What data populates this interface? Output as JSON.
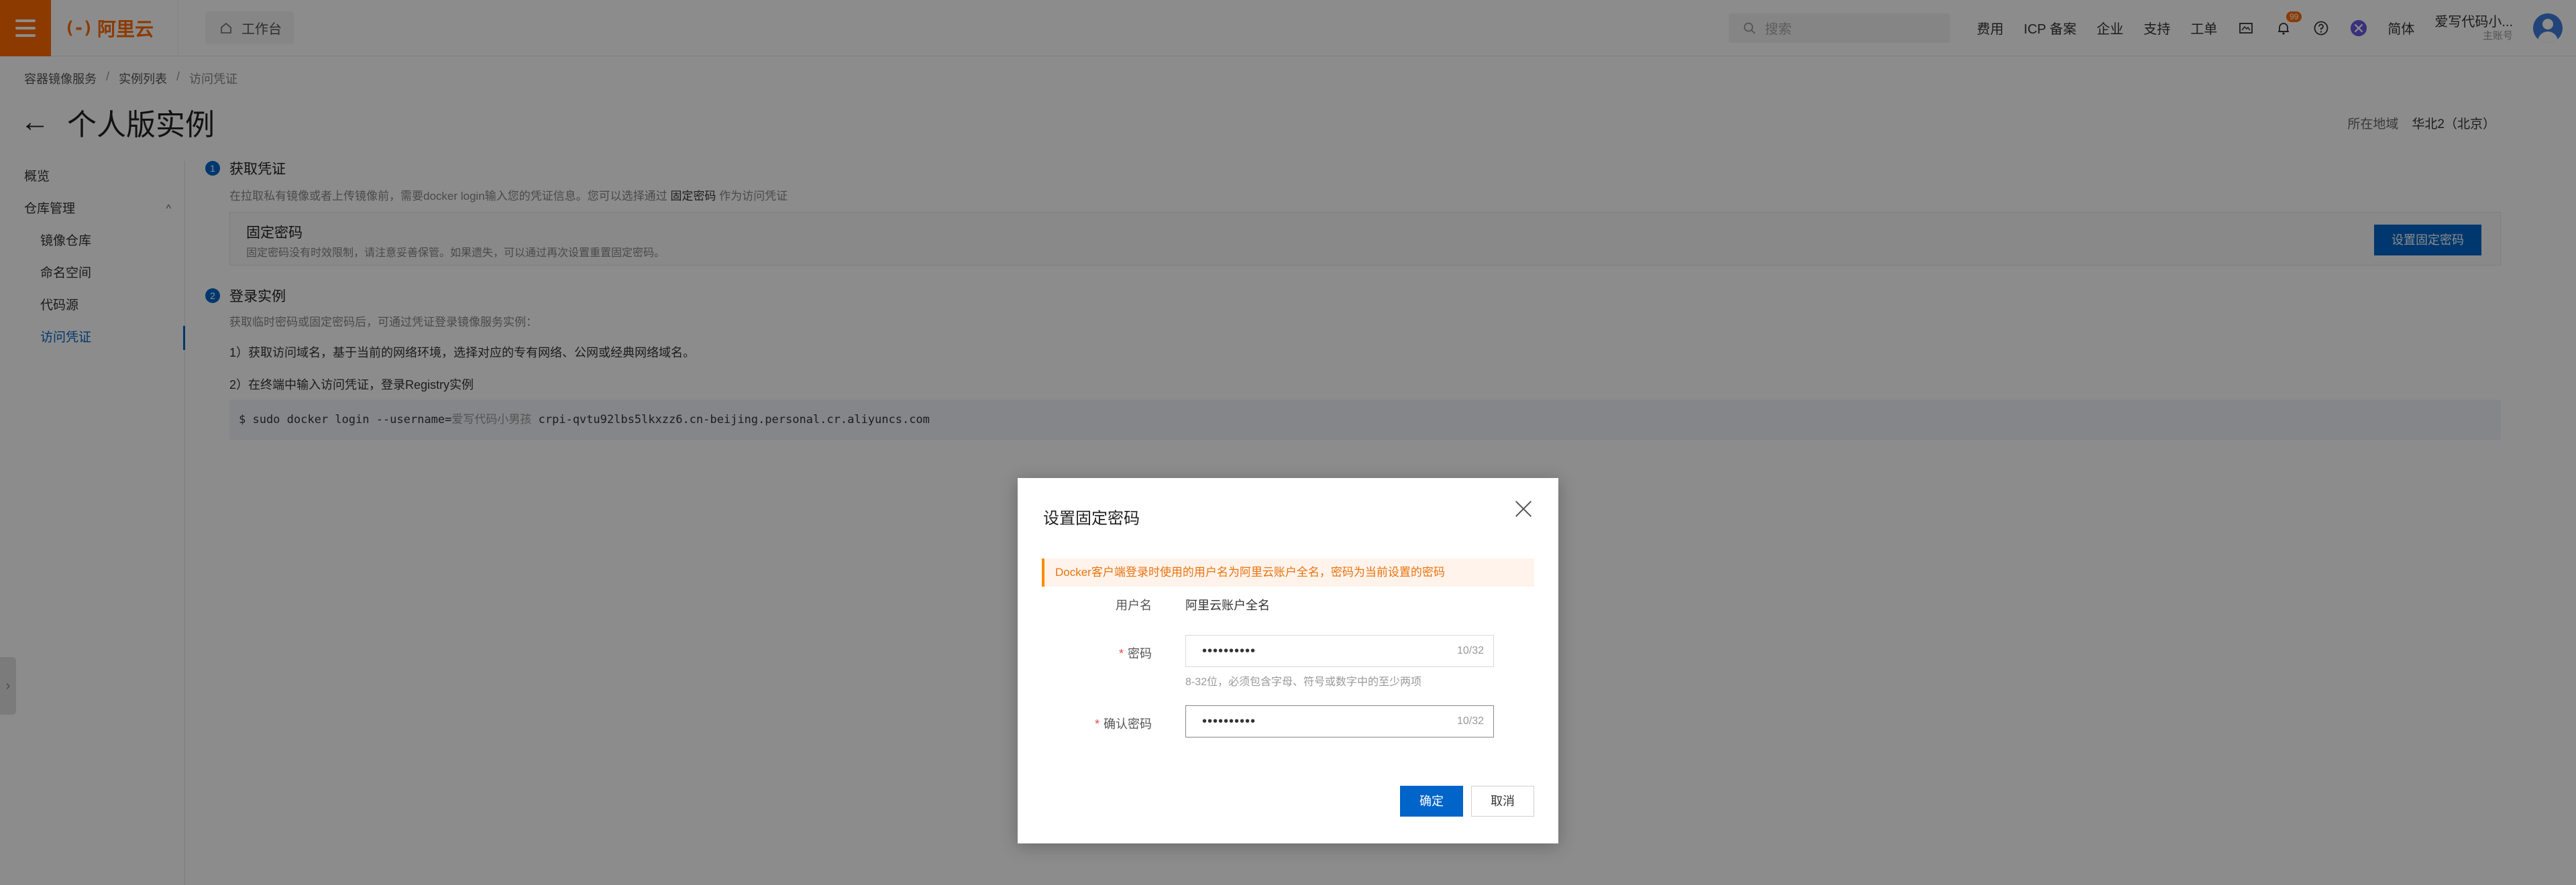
{
  "topbar": {
    "logo_mark": "(-)",
    "logo_text": "阿里云",
    "workbench": "工作台",
    "search_placeholder": "搜索",
    "links": [
      "费用",
      "ICP 备案",
      "企业",
      "支持",
      "工单"
    ],
    "notification_badge": "99",
    "language": "简体",
    "user_name": "爱写代码小...",
    "user_role": "主账号"
  },
  "breadcrumb": [
    "容器镜像服务",
    "实例列表",
    "访问凭证"
  ],
  "page": {
    "title": "个人版实例",
    "region_label": "所在地域",
    "region_value": "华北2（北京）"
  },
  "sidebar": {
    "items": [
      {
        "label": "概览"
      },
      {
        "label": "仓库管理"
      },
      {
        "label": "镜像仓库"
      },
      {
        "label": "命名空间"
      },
      {
        "label": "代码源"
      },
      {
        "label": "访问凭证"
      }
    ]
  },
  "content": {
    "step1": {
      "num": "1",
      "title": "获取凭证",
      "desc_prefix": "在拉取私有镜像或者上传镜像前，需要docker login输入您的凭证信息。您可以选择通过",
      "desc_bold": "固定密码",
      "desc_suffix": "作为访问凭证"
    },
    "card": {
      "title": "固定密码",
      "desc": "固定密码没有时效限制，请注意妥善保管。如果遗失，可以通过再次设置重置固定密码。",
      "button": "设置固定密码"
    },
    "step2": {
      "num": "2",
      "title": "登录实例",
      "desc": "获取临时密码或固定密码后，可通过凭证登录镜像服务实例："
    },
    "instr1": "1）获取访问域名，基于当前的网络环境，选择对应的专有网络、公网或经典网络域名。",
    "instr2": "2）在终端中输入访问凭证，登录Registry实例",
    "cmd_prefix": "$ sudo docker login --username=",
    "cmd_user": "爱写代码小男孩",
    "cmd_suffix": " crpi-qvtu92lbs5lkxzz6.cn-beijing.personal.cr.aliyuncs.com"
  },
  "modal": {
    "title": "设置固定密码",
    "alert": "Docker客户端登录时使用的用户名为阿里云账户全名，密码为当前设置的密码",
    "username_label": "用户名",
    "username_value": "阿里云账户全名",
    "password_label": "密码",
    "password_value": "••••••••••",
    "password_count": "10/32",
    "password_hint": "8-32位，必须包含字母、符号或数字中的至少两项",
    "confirm_label": "确认密码",
    "confirm_value": "••••••••••",
    "confirm_count": "10/32",
    "ok": "确定",
    "cancel": "取消"
  }
}
